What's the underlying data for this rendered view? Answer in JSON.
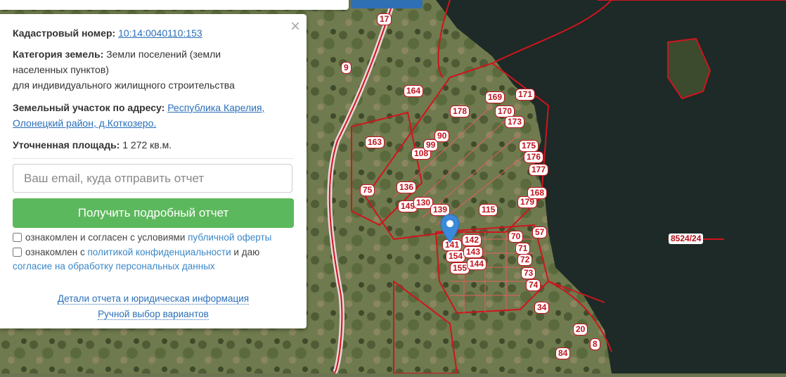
{
  "popup": {
    "close_icon": "×",
    "cadastral_label": "Кадастровый номер:",
    "cadastral_value": "10:14:0040110:153",
    "category_label": "Категория земель:",
    "category_value_1": "Земли поселений (земли",
    "category_value_2": "населенных пунктов)",
    "category_value_3": "для индивидуального жилищного строительства",
    "address_label": "Земельный участок по адресу:",
    "address_value_1": "Республика Карелия,",
    "address_value_2": "Олонецкий район, д.Коткозеро.",
    "area_label": "Уточненная площадь:",
    "area_value": "1 272 кв.м.",
    "email_placeholder": "Ваш email, куда отправить отчет",
    "get_report_button": "Получить подробный отчет",
    "consent1_text": "ознакомлен и согласен с условиями",
    "consent1_link": "публичной оферты",
    "consent2_text_a": "ознакомлен с",
    "consent2_link_a": "политикой конфиденциальности",
    "consent2_text_b": "и даю",
    "consent2_link_b": "согласие на обработку персональных данных",
    "details_link": "Детали отчета и юридическая информация",
    "manual_link": "Ручной выбор вариантов"
  },
  "map": {
    "marker_icon": "map-pin",
    "marker_color": "#3b8ad9",
    "boundary_color": "#d0141e",
    "plot_labels": [
      "17",
      "9",
      "164",
      "163",
      "75",
      "169",
      "171",
      "170",
      "173",
      "175",
      "176",
      "177",
      "178",
      "179",
      "168",
      "70",
      "71",
      "72",
      "73",
      "74",
      "57",
      "34",
      "20",
      "8",
      "84",
      "8524/24",
      "141",
      "142",
      "154",
      "143",
      "155",
      "144",
      "115",
      "108",
      "99",
      "90",
      "136",
      "149",
      "130",
      "139"
    ]
  }
}
